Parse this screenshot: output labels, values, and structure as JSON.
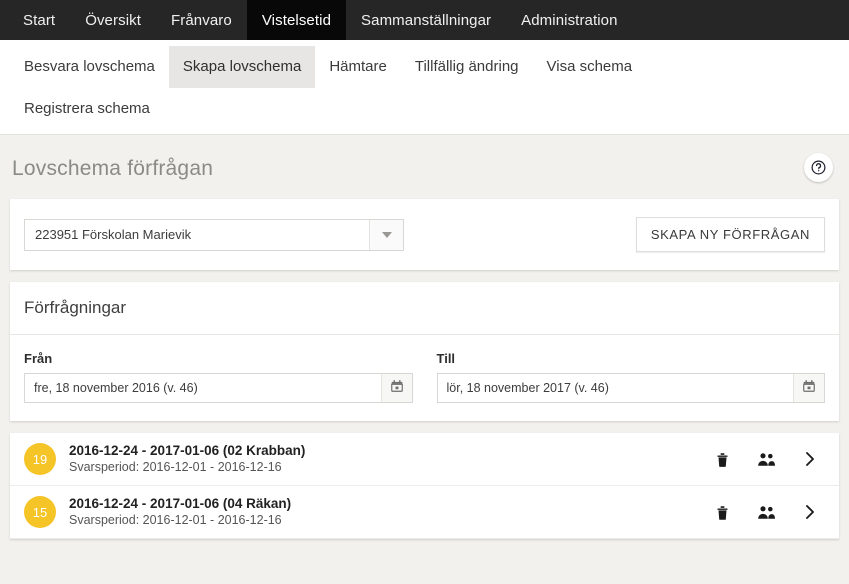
{
  "topnav": {
    "items": [
      {
        "label": "Start",
        "active": false
      },
      {
        "label": "Översikt",
        "active": false
      },
      {
        "label": "Frånvaro",
        "active": false
      },
      {
        "label": "Vistelsetid",
        "active": true
      },
      {
        "label": "Sammanställningar",
        "active": false
      },
      {
        "label": "Administration",
        "active": false
      }
    ]
  },
  "subnav": {
    "items": [
      {
        "label": "Besvara lovschema",
        "active": false
      },
      {
        "label": "Skapa lovschema",
        "active": true
      },
      {
        "label": "Hämtare",
        "active": false
      },
      {
        "label": "Tillfällig ändring",
        "active": false
      },
      {
        "label": "Visa schema",
        "active": false
      },
      {
        "label": "Registrera schema",
        "active": false
      }
    ]
  },
  "page": {
    "title": "Lovschema förfrågan",
    "help_icon": "question-circle-icon"
  },
  "unit_select": {
    "value": "223951 Förskolan Marievik",
    "arrow_icon": "chevron-down-icon"
  },
  "create_button": {
    "label": "SKAPA NY FÖRFRÅGAN"
  },
  "requests_section": {
    "title": "Förfrågningar",
    "from": {
      "label": "Från",
      "value": "fre, 18 november 2016 (v. 46)",
      "placeholder": "Välj datum",
      "icon": "calendar-icon"
    },
    "to": {
      "label": "Till",
      "value": "lör, 18 november 2017 (v. 46)",
      "placeholder": "Välj datum",
      "icon": "calendar-icon"
    }
  },
  "requests": {
    "badge_color": "#f5c427",
    "rows": [
      {
        "count": "19",
        "title": "2016-12-24 - 2017-01-06 (02 Krabban)",
        "subtitle": "Svarsperiod: 2016-12-01 - 2016-12-16",
        "actions": [
          "trash-icon",
          "people-icon",
          "chevron-right-icon"
        ]
      },
      {
        "count": "15",
        "title": "2016-12-24 - 2017-01-06 (04 Räkan)",
        "subtitle": "Svarsperiod: 2016-12-01 - 2016-12-16",
        "actions": [
          "trash-icon",
          "people-icon",
          "chevron-right-icon"
        ]
      }
    ]
  }
}
